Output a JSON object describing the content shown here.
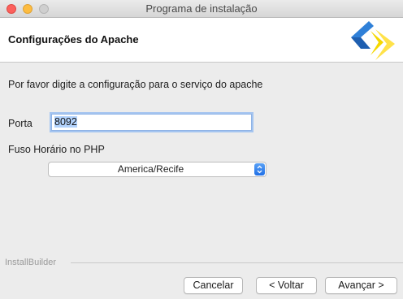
{
  "window": {
    "title": "Programa de instalação"
  },
  "header": {
    "title": "Configurações do Apache",
    "logo_icon": "installbuilder-logo-icon"
  },
  "form": {
    "description": "Por favor digite a configuração para o serviço do apache",
    "port": {
      "label": "Porta",
      "value": "8092"
    },
    "timezone": {
      "label": "Fuso Horário no PHP",
      "selected": "America/Recife"
    }
  },
  "footer": {
    "brand": "InstallBuilder"
  },
  "buttons": {
    "cancel": "Cancelar",
    "back": "< Voltar",
    "next": "Avançar >"
  },
  "colors": {
    "select_arrow": "#2a7ff0",
    "logo_blue": "#2f80d8",
    "logo_yellow": "#f5d800"
  }
}
